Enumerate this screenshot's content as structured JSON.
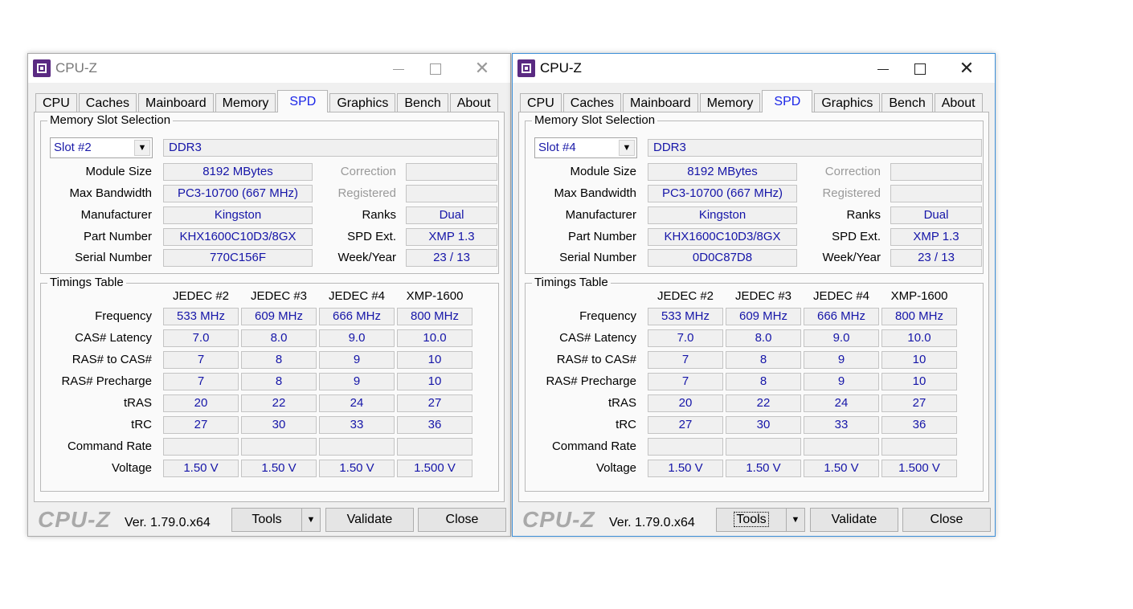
{
  "windows": [
    {
      "title": "CPU-Z",
      "tabs": [
        "CPU",
        "Caches",
        "Mainboard",
        "Memory",
        "SPD",
        "Graphics",
        "Bench",
        "About"
      ],
      "active_tab": "SPD",
      "slot_group_label": "Memory Slot Selection",
      "slot": "Slot #2",
      "memory_type": "DDR3",
      "labels": {
        "module_size": "Module Size",
        "max_bandwidth": "Max Bandwidth",
        "manufacturer": "Manufacturer",
        "part_number": "Part Number",
        "serial_number": "Serial Number",
        "correction": "Correction",
        "registered": "Registered",
        "ranks": "Ranks",
        "spd_ext": "SPD Ext.",
        "week_year": "Week/Year"
      },
      "values": {
        "module_size": "8192 MBytes",
        "max_bandwidth": "PC3-10700 (667 MHz)",
        "manufacturer": "Kingston",
        "part_number": "KHX1600C10D3/8GX",
        "serial_number": "770C156F",
        "correction": "",
        "registered": "",
        "ranks": "Dual",
        "spd_ext": "XMP 1.3",
        "week_year": "23 / 13"
      },
      "timings_label": "Timings Table",
      "timing_columns": [
        "JEDEC #2",
        "JEDEC #3",
        "JEDEC #4",
        "XMP-1600"
      ],
      "timing_rows": [
        {
          "label": "Frequency",
          "values": [
            "533 MHz",
            "609 MHz",
            "666 MHz",
            "800 MHz"
          ]
        },
        {
          "label": "CAS# Latency",
          "values": [
            "7.0",
            "8.0",
            "9.0",
            "10.0"
          ]
        },
        {
          "label": "RAS# to CAS#",
          "values": [
            "7",
            "8",
            "9",
            "10"
          ]
        },
        {
          "label": "RAS# Precharge",
          "values": [
            "7",
            "8",
            "9",
            "10"
          ]
        },
        {
          "label": "tRAS",
          "values": [
            "20",
            "22",
            "24",
            "27"
          ]
        },
        {
          "label": "tRC",
          "values": [
            "27",
            "30",
            "33",
            "36"
          ]
        },
        {
          "label": "Command Rate",
          "values": [
            "",
            "",
            "",
            ""
          ]
        },
        {
          "label": "Voltage",
          "values": [
            "1.50 V",
            "1.50 V",
            "1.50 V",
            "1.500 V"
          ]
        }
      ],
      "brand": "CPU-Z",
      "version": "Ver. 1.79.0.x64",
      "buttons": {
        "tools": "Tools",
        "validate": "Validate",
        "close": "Close"
      }
    },
    {
      "title": "CPU-Z",
      "tabs": [
        "CPU",
        "Caches",
        "Mainboard",
        "Memory",
        "SPD",
        "Graphics",
        "Bench",
        "About"
      ],
      "active_tab": "SPD",
      "slot_group_label": "Memory Slot Selection",
      "slot": "Slot #4",
      "memory_type": "DDR3",
      "labels": {
        "module_size": "Module Size",
        "max_bandwidth": "Max Bandwidth",
        "manufacturer": "Manufacturer",
        "part_number": "Part Number",
        "serial_number": "Serial Number",
        "correction": "Correction",
        "registered": "Registered",
        "ranks": "Ranks",
        "spd_ext": "SPD Ext.",
        "week_year": "Week/Year"
      },
      "values": {
        "module_size": "8192 MBytes",
        "max_bandwidth": "PC3-10700 (667 MHz)",
        "manufacturer": "Kingston",
        "part_number": "KHX1600C10D3/8GX",
        "serial_number": "0D0C87D8",
        "correction": "",
        "registered": "",
        "ranks": "Dual",
        "spd_ext": "XMP 1.3",
        "week_year": "23 / 13"
      },
      "timings_label": "Timings Table",
      "timing_columns": [
        "JEDEC #2",
        "JEDEC #3",
        "JEDEC #4",
        "XMP-1600"
      ],
      "timing_rows": [
        {
          "label": "Frequency",
          "values": [
            "533 MHz",
            "609 MHz",
            "666 MHz",
            "800 MHz"
          ]
        },
        {
          "label": "CAS# Latency",
          "values": [
            "7.0",
            "8.0",
            "9.0",
            "10.0"
          ]
        },
        {
          "label": "RAS# to CAS#",
          "values": [
            "7",
            "8",
            "9",
            "10"
          ]
        },
        {
          "label": "RAS# Precharge",
          "values": [
            "7",
            "8",
            "9",
            "10"
          ]
        },
        {
          "label": "tRAS",
          "values": [
            "20",
            "22",
            "24",
            "27"
          ]
        },
        {
          "label": "tRC",
          "values": [
            "27",
            "30",
            "33",
            "36"
          ]
        },
        {
          "label": "Command Rate",
          "values": [
            "",
            "",
            "",
            ""
          ]
        },
        {
          "label": "Voltage",
          "values": [
            "1.50 V",
            "1.50 V",
            "1.50 V",
            "1.500 V"
          ]
        }
      ],
      "brand": "CPU-Z",
      "version": "Ver. 1.79.0.x64",
      "buttons": {
        "tools": "Tools",
        "validate": "Validate",
        "close": "Close"
      }
    }
  ]
}
